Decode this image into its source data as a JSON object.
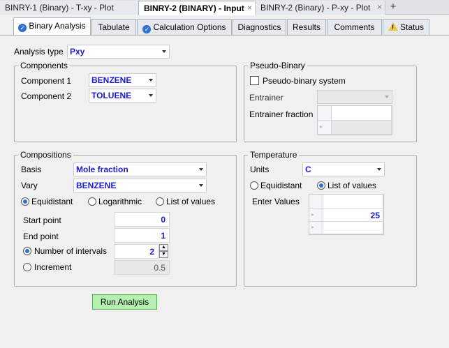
{
  "doc_tabs": [
    {
      "label": "BINRY-1 (Binary) - T-xy - Plot"
    },
    {
      "label": "BINRY-2 (BINARY) - Input"
    },
    {
      "label": "BINRY-2 (Binary) - P-xy - Plot"
    }
  ],
  "form_tabs": [
    {
      "label": "Binary Analysis",
      "icon": "check-circle-icon"
    },
    {
      "label": "Tabulate"
    },
    {
      "label": "Calculation Options",
      "icon": "check-circle-icon"
    },
    {
      "label": "Diagnostics"
    },
    {
      "label": "Results"
    },
    {
      "label": "Comments"
    },
    {
      "label": "Status",
      "icon": "warning-icon"
    }
  ],
  "analysis_type": {
    "label": "Analysis type",
    "value": "Pxy"
  },
  "components": {
    "legend": "Components",
    "component1_label": "Component 1",
    "component1_value": "BENZENE",
    "component2_label": "Component 2",
    "component2_value": "TOLUENE"
  },
  "pseudo_binary": {
    "legend": "Pseudo-Binary",
    "checkbox_label": "Pseudo-binary system",
    "checked": false,
    "entrainer_label": "Entrainer",
    "entrainer_value": "",
    "entrainer_fraction_label": "Entrainer fraction"
  },
  "compositions": {
    "legend": "Compositions",
    "basis_label": "Basis",
    "basis_value": "Mole fraction",
    "vary_label": "Vary",
    "vary_value": "BENZENE",
    "mode_options": [
      "Equidistant",
      "Logarithmic",
      "List of values"
    ],
    "mode_selected": "Equidistant",
    "start_label": "Start point",
    "start_value": "0",
    "end_label": "End point",
    "end_value": "1",
    "intervals_label": "Number of intervals",
    "intervals_value": "2",
    "increment_label": "Increment",
    "increment_value": "0.5",
    "step_selected": "Number of intervals"
  },
  "temperature": {
    "legend": "Temperature",
    "units_label": "Units",
    "units_value": "C",
    "mode_options": [
      "Equidistant",
      "List of values"
    ],
    "mode_selected": "List of values",
    "enter_values_label": "Enter Values",
    "values": [
      "25"
    ]
  },
  "run_button": "Run Analysis",
  "new_tab_symbol": "+",
  "close_symbol": "×",
  "colors": {
    "value_text": "#1a1ad6",
    "run_button": "#b6f0b0",
    "check_icon": "#2d6fd2",
    "warning_icon": "#f2c230"
  }
}
